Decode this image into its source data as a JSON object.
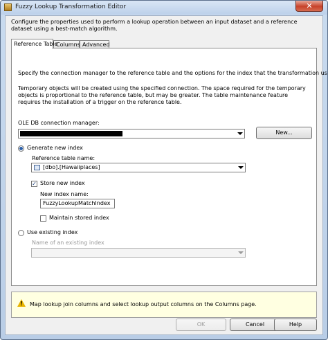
{
  "window": {
    "title": "Fuzzy Lookup Transformation Editor",
    "close_glyph": "✕"
  },
  "description": "Configure the properties used to perform a lookup operation between an input dataset and a reference dataset using a best-match algorithm.",
  "tabs": [
    {
      "label": "Reference Table",
      "active": true
    },
    {
      "label": "Columns",
      "active": false
    },
    {
      "label": "Advanced",
      "active": false
    }
  ],
  "panel": {
    "intro": "Specify the connection manager to the reference table and the options for the index that the transformation uses.",
    "temp_note": "Temporary objects will be created using the specified connection. The space required for the temporary objects is proportional to the reference table, but may be greater. The table maintenance feature requires the installation of a trigger on the reference table.",
    "connection_label": "OLE DB connection manager:",
    "new_button": "New...",
    "generate_new_index": {
      "label": "Generate new index",
      "checked": true
    },
    "reference_table_label": "Reference table name:",
    "reference_table_value": "[dbo].[Hawaiiplaces]",
    "store_new_index": {
      "label": "Store new index",
      "checked": true,
      "glyph": "✓"
    },
    "new_index_name_label": "New index name:",
    "new_index_name_value": "FuzzyLookupMatchIndex",
    "maintain_stored_index": {
      "label": "Maintain stored index",
      "checked": false
    },
    "use_existing_index": {
      "label": "Use existing index",
      "checked": false
    },
    "existing_index_label": "Name of an existing index",
    "existing_index_value": ""
  },
  "info": {
    "text": "Map lookup join columns and select lookup output columns on the Columns page.",
    "warn_glyph": "!"
  },
  "buttons": {
    "ok": "OK",
    "cancel": "Cancel",
    "help": "Help"
  }
}
